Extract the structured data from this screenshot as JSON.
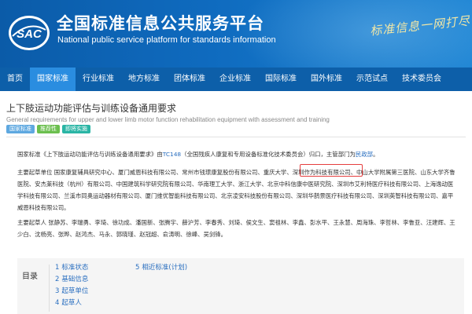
{
  "header": {
    "logo_text": "SAC",
    "title": "全国标准信息公共服务平台",
    "subtitle": "National public service platform  for standards information",
    "slogan": "标准信息一网打尽",
    "background_color": "#0f6bbf"
  },
  "nav": {
    "items": [
      {
        "label": "首页",
        "active": false
      },
      {
        "label": "国家标准",
        "active": true
      },
      {
        "label": "行业标准",
        "active": false
      },
      {
        "label": "地方标准",
        "active": false
      },
      {
        "label": "团体标准",
        "active": false
      },
      {
        "label": "企业标准",
        "active": false
      },
      {
        "label": "国际标准",
        "active": false
      },
      {
        "label": "国外标准",
        "active": false
      },
      {
        "label": "示范试点",
        "active": false
      },
      {
        "label": "技术委员会",
        "active": false
      }
    ],
    "active_color": "#2a8de0"
  },
  "standard": {
    "title": "上下肢运动功能评估与训练设备通用要求",
    "english_title": "General requirements for upper and lower limb motor function rehabilitation equipment with assessment and training",
    "badges": [
      {
        "label": "国家标准",
        "color": "#5ea8e0"
      },
      {
        "label": "推荐性",
        "color": "#6bbf4e"
      },
      {
        "label": "即将实施",
        "color": "#2ab5a5"
      }
    ],
    "intro": {
      "prefix": "国家标准《上下肢运动功能评估与训练设备通用要求》由",
      "tc_link": "TC148",
      "middle": "（全国残疾人康复和专用设备标准化技术委员会）归口，主管部门为",
      "dept_link": "民政部",
      "suffix": "。"
    },
    "drafting_units_before": "主要起草单位 国家康复辅具研究中心、厦门威恩科技有限公司、常州市钱璟康复股份有限公司、重庆大学、",
    "highlighted_unit": "深圳作为科技有限公司",
    "drafting_units_after": "、中山大学附属第三医院、山东大学齐鲁医院、安杰莱科技（杭州）有限公司、中国建筑科学研究院有限公司、华南理工大学、浙江大学、北京中科信康中医研究院、深圳市艾利特医疗科技有限公司、上海逸动医学科技有限公司、兰溪市同奥运动器材有限公司、厦门维优智能科技有限公司、北京凌安科技股份有限公司、深圳华鹊景医疗科技有限公司、深圳英智科技有限公司、嘉平威恩科技有限公司。",
    "drafters": "主要起草人 张静苏、李瑞勇、李琦、徐功成、潘国新、张腾宇、薛沪芳、李春秀、刘琦、侯文生、窦祖林、李鑫、彭水平、王永慧、周海珠、李哲林、李鲁亚、汪建辉、王少白、沈杨亮、张晔、赵鸿杰、马永、郭晓瑾、赵冠超、俞涛明、徐峰、吴剑锋。"
  },
  "toc": {
    "label": "目录",
    "items": [
      {
        "num": "1",
        "label": "标准状态"
      },
      {
        "num": "2",
        "label": "基础信息"
      },
      {
        "num": "3",
        "label": "起草单位"
      },
      {
        "num": "4",
        "label": "起草人"
      },
      {
        "num": "5",
        "label": "相近标准(计划)"
      }
    ]
  }
}
